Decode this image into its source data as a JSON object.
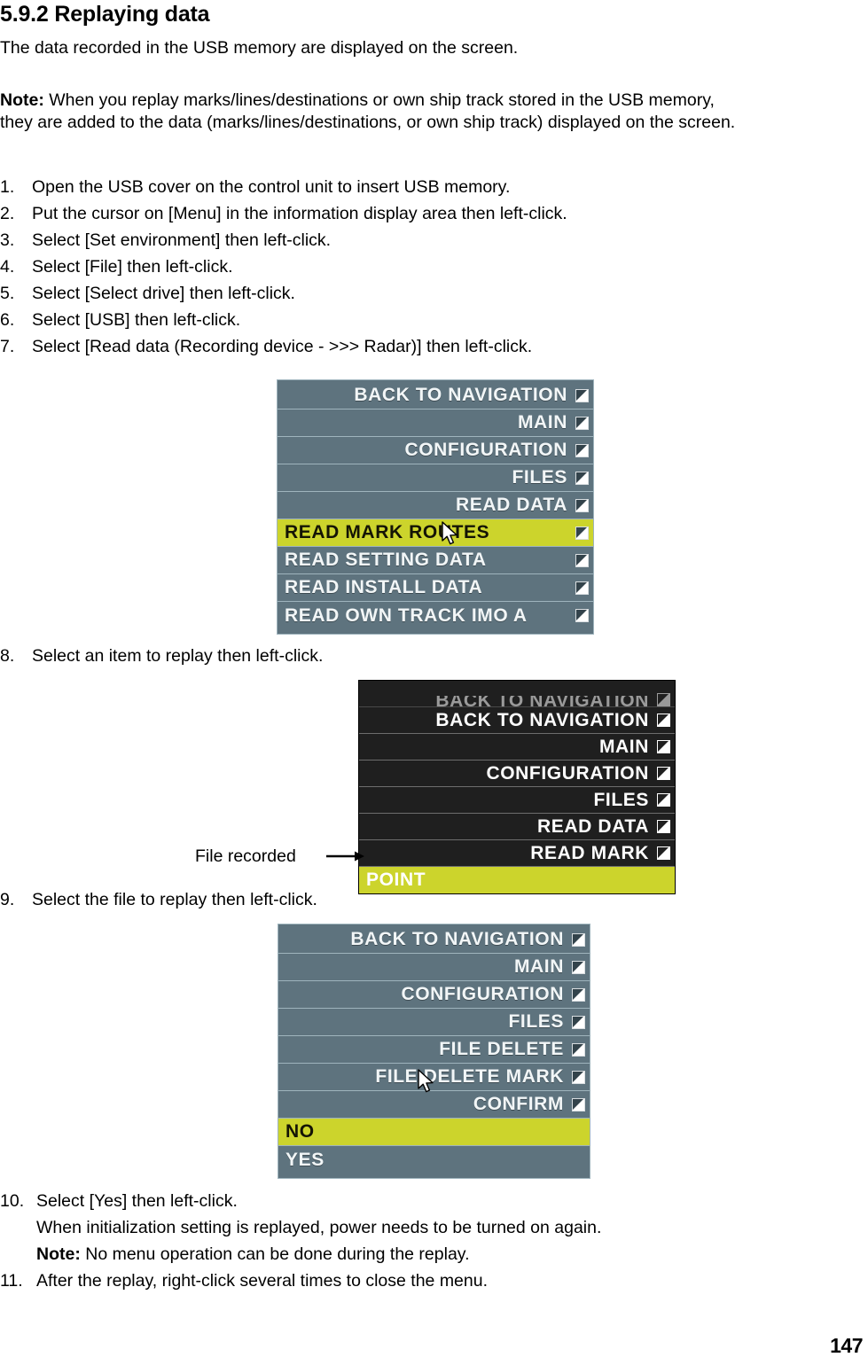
{
  "document": {
    "section_number": "5.9.2",
    "heading": "5.9.2 Replaying data",
    "intro": "The data recorded in the USB memory are displayed on the screen.",
    "note_label": "Note:",
    "note_line1": "When you replay marks/lines/destinations or own ship track stored in the USB memory,",
    "note_line2": "they are added to the data (marks/lines/destinations, or own ship track) displayed on the screen.",
    "page_number": "147"
  },
  "steps": [
    {
      "num": "1.",
      "text": "Open the USB cover on the control unit to insert USB memory."
    },
    {
      "num": "2.",
      "text": "Put the cursor on [Menu] in the information display area then left-click."
    },
    {
      "num": "3.",
      "text": "Select [Set environment] then left-click."
    },
    {
      "num": "4.",
      "text": "Select [File] then left-click."
    },
    {
      "num": "5.",
      "text": "Select [Select drive] then left-click."
    },
    {
      "num": "6.",
      "text": "Select [USB] then left-click."
    },
    {
      "num": "7.",
      "text": "Select [Read data (Recording device - >>> Radar)] then left-click."
    }
  ],
  "step8": {
    "num": "8.",
    "text": "Select an item to replay then left-click."
  },
  "step9": {
    "num": "9.",
    "text": "Select the file to replay then left-click."
  },
  "step10": {
    "num": "10.",
    "text": "Select [Yes] then left-click.",
    "sub": "When initialization setting is replayed, power needs to be turned on again.",
    "note_label": "Note:",
    "note_text": "No menu operation can be done during the replay."
  },
  "step11": {
    "num": "11.",
    "text": "After the replay, right-click several times to close the menu."
  },
  "callout": {
    "file_recorded": "File recorded"
  },
  "colors": {
    "menu_slate_bg": "#5e737e",
    "menu_slate_border": "#9fb4bd",
    "menu_dark_bg": "#1f1f1f",
    "menu_dark_border": "#6d6d6d",
    "highlight_yellow": "#ccd42c",
    "label_white": "#f2f6f7",
    "text_black": "#000000"
  },
  "menu1": {
    "name": "read-data-menu",
    "style": "slate",
    "rows": [
      {
        "label": "BACK TO NAVIGATION",
        "align": "right",
        "selected": false,
        "icon": "submenu-arrow-icon"
      },
      {
        "label": "MAIN",
        "align": "right",
        "selected": false,
        "icon": "submenu-arrow-icon"
      },
      {
        "label": "CONFIGURATION",
        "align": "right",
        "selected": false,
        "icon": "submenu-arrow-icon"
      },
      {
        "label": "FILES",
        "align": "right",
        "selected": false,
        "icon": "submenu-arrow-icon"
      },
      {
        "label": "READ DATA",
        "align": "right",
        "selected": false,
        "icon": "submenu-arrow-icon"
      },
      {
        "label": "READ MARK ROUTES",
        "align": "left",
        "selected": true,
        "icon": "submenu-arrow-icon"
      },
      {
        "label": "READ SETTING DATA",
        "align": "left",
        "selected": false,
        "icon": "submenu-arrow-icon"
      },
      {
        "label": "READ INSTALL DATA",
        "align": "left",
        "selected": false,
        "icon": "submenu-arrow-icon"
      },
      {
        "label": "READ OWN TRACK IMO A",
        "align": "left",
        "selected": false,
        "icon": "submenu-arrow-icon"
      }
    ]
  },
  "menu2": {
    "name": "read-mark-file-menu",
    "style": "dark",
    "clipped_top_row": true,
    "rows": [
      {
        "label": "BACK TO NAVIGATION",
        "align": "right",
        "selected": false,
        "icon": "submenu-arrow-icon"
      },
      {
        "label": "MAIN",
        "align": "right",
        "selected": false,
        "icon": "submenu-arrow-icon"
      },
      {
        "label": "CONFIGURATION",
        "align": "right",
        "selected": false,
        "icon": "submenu-arrow-icon"
      },
      {
        "label": "FILES",
        "align": "right",
        "selected": false,
        "icon": "submenu-arrow-icon"
      },
      {
        "label": "READ DATA",
        "align": "right",
        "selected": false,
        "icon": "submenu-arrow-icon"
      },
      {
        "label": "READ MARK",
        "align": "right",
        "selected": false,
        "icon": "submenu-arrow-icon"
      },
      {
        "label": "POINT",
        "align": "left",
        "selected": true,
        "icon": "none"
      }
    ]
  },
  "menu3": {
    "name": "file-delete-confirm-menu",
    "style": "slate",
    "rows": [
      {
        "label": "BACK TO NAVIGATION",
        "align": "right",
        "selected": false,
        "icon": "submenu-arrow-icon"
      },
      {
        "label": "MAIN",
        "align": "right",
        "selected": false,
        "icon": "submenu-arrow-icon"
      },
      {
        "label": "CONFIGURATION",
        "align": "right",
        "selected": false,
        "icon": "submenu-arrow-icon"
      },
      {
        "label": "FILES",
        "align": "right",
        "selected": false,
        "icon": "submenu-arrow-icon"
      },
      {
        "label": "FILE DELETE",
        "align": "right",
        "selected": false,
        "icon": "submenu-arrow-icon"
      },
      {
        "label": "FILE DELETE MARK",
        "align": "right",
        "selected": false,
        "icon": "submenu-arrow-icon"
      },
      {
        "label": "CONFIRM",
        "align": "right",
        "selected": false,
        "icon": "submenu-arrow-icon"
      },
      {
        "label": "NO",
        "align": "left",
        "selected": true,
        "icon": "none"
      },
      {
        "label": "YES",
        "align": "left",
        "selected": false,
        "icon": "none"
      }
    ]
  }
}
